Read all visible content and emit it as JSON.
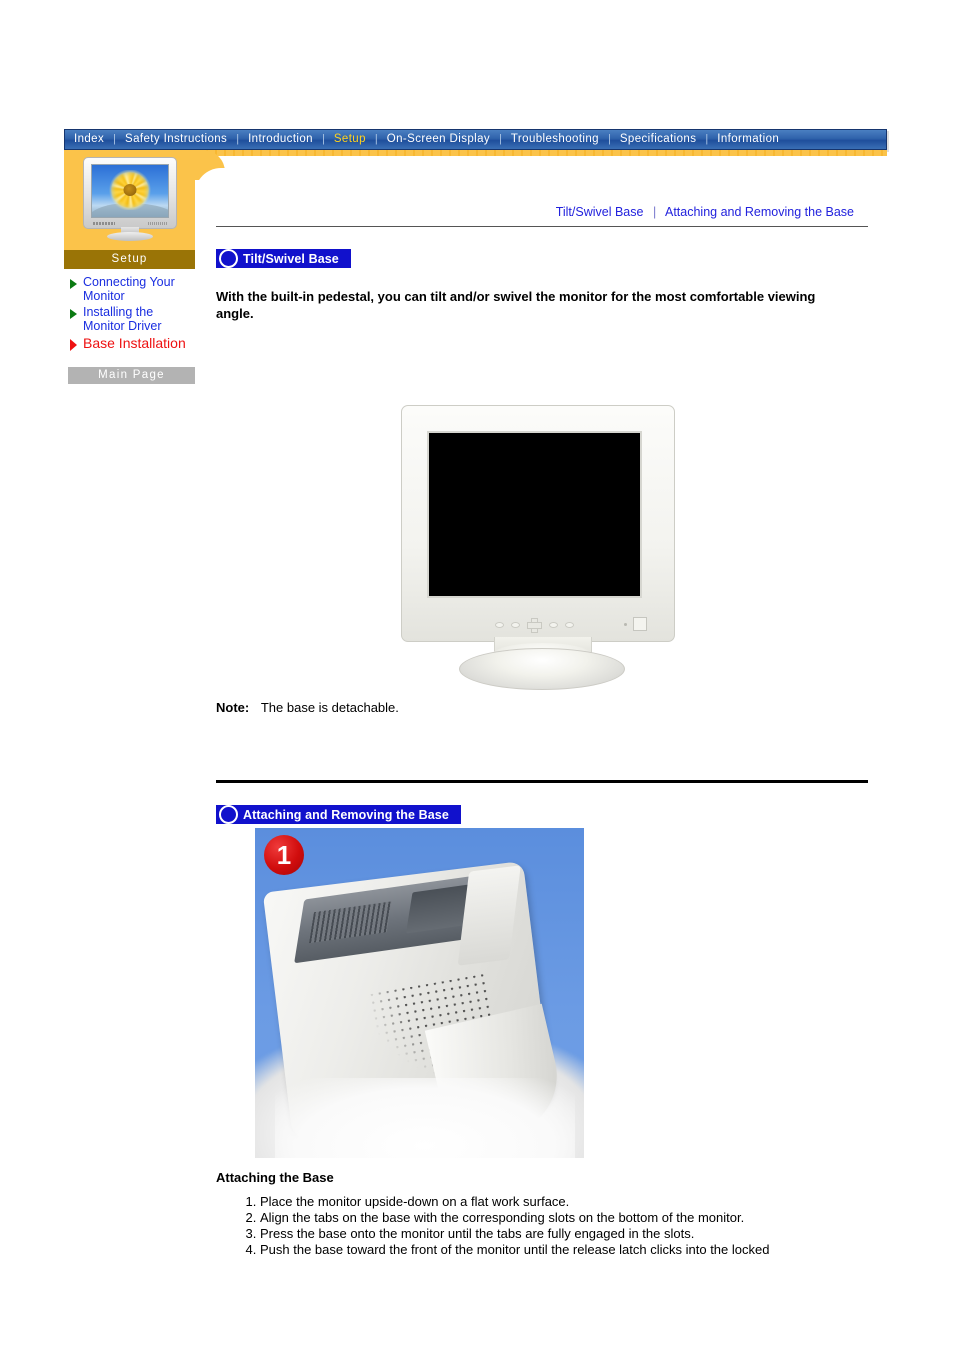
{
  "nav": {
    "items": [
      {
        "label": "Index",
        "active": false
      },
      {
        "label": "Safety Instructions",
        "active": false
      },
      {
        "label": "Introduction",
        "active": false
      },
      {
        "label": "Setup",
        "active": true
      },
      {
        "label": "On-Screen Display",
        "active": false
      },
      {
        "label": "Troubleshooting",
        "active": false
      },
      {
        "label": "Specifications",
        "active": false
      },
      {
        "label": "Information",
        "active": false
      }
    ],
    "separator": "|"
  },
  "sidebar": {
    "title": "Setup",
    "links": [
      {
        "label": "Connecting Your Monitor",
        "current": false
      },
      {
        "label": "Installing the Monitor Driver",
        "current": false
      },
      {
        "label": "Base Installation",
        "current": true
      }
    ],
    "main_page_button": "Main Page"
  },
  "breadcrumb": {
    "first": "Tilt/Swivel Base",
    "separator": "|",
    "second": "Attaching and Removing the Base"
  },
  "section1": {
    "banner": "Tilt/Swivel Base",
    "intro": "With the built-in pedestal, you can tilt and/or swivel the monitor for the most comfortable viewing angle.",
    "note_label": "Note:",
    "note_text": "The base is detachable."
  },
  "section2": {
    "banner": "Attaching and Removing the Base",
    "photo_badge": "1",
    "howto_title": "Attaching the Base",
    "steps": [
      "Place the monitor upside-down on a flat work surface.",
      "Align the tabs on the base with the corresponding slots on the bottom of the monitor.",
      "Press the base onto the monitor until the tabs are fully engaged in the slots.",
      "Push the base toward the front of the monitor until the release latch clicks into the locked"
    ]
  },
  "colors": {
    "nav_blue": "#1f4f9c",
    "nav_active_text": "#ffd21e",
    "sidebar_amber": "#fbc34a",
    "sidebar_title_bar": "#9a7406",
    "banner_blue": "#1111cc",
    "link_blue": "#1a2ee0",
    "current_link_red": "#ee1111",
    "badge_red": "#d10d0d",
    "main_page_gray": "#b3b3b3"
  }
}
